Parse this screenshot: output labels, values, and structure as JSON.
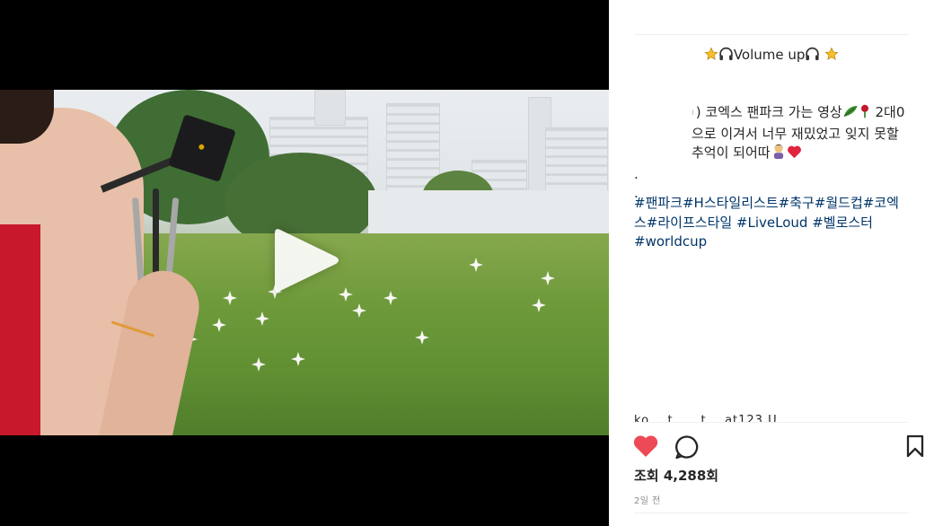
{
  "video": {
    "play_icon": "play-icon"
  },
  "post": {
    "volume_line": "Volume up",
    "volume_emojis": [
      "star-icon",
      "headphones-icon",
      "headphones-icon",
      "star-icon"
    ],
    "caption_hidden_start": "ı",
    "caption_text": ") 코엑스 팬파크 가는 영상",
    "caption_text_2": " 2대0으로 이겨서 너무 재밌었고 잊지 못할 추억이 되어따",
    "caption_dots": [
      ".",
      "."
    ],
    "hashtags_line1": "#팬파크#H스타일리스트#축구#월드컵#코엑스#라이프스타일 #LiveLoud #벨로스터",
    "hashtags_line2": "#worldcup"
  },
  "actions": {
    "like_icon": "heart-filled-icon",
    "comment_icon": "comment-icon",
    "save_icon": "bookmark-icon",
    "like_color": "#ed4956"
  },
  "stats": {
    "views_label": "조회 4,288회",
    "time_ago": "2일 전"
  }
}
